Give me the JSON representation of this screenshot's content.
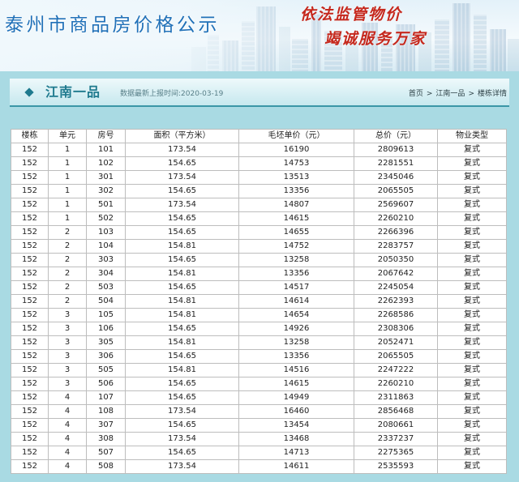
{
  "colors": {
    "page_background": "#a9dae3",
    "banner_title_blue": "#2171b8",
    "slogan_red": "#c5281d",
    "section_teal": "#1f7a8e",
    "table_border": "#bdbdbd"
  },
  "icons": {
    "section_bullet": "diamond-icon"
  },
  "banner": {
    "title": "泰州市商品房价格公示",
    "slogan": [
      "依法监管物价",
      "竭诚服务万家"
    ]
  },
  "section": {
    "title": "江南一品",
    "update_time": "数据最新上报时间:2020-03-19"
  },
  "breadcrumb": {
    "separator": ">",
    "items": [
      {
        "label": "首页"
      },
      {
        "label": "江南一品"
      },
      {
        "label": "楼栋详情"
      }
    ]
  },
  "table": {
    "columns": [
      "楼栋",
      "单元",
      "房号",
      "面积（平方米）",
      "毛坯单价（元）",
      "总价（元）",
      "物业类型"
    ],
    "rows": [
      [
        "152",
        "1",
        "101",
        "173.54",
        "16190",
        "2809613",
        "复式"
      ],
      [
        "152",
        "1",
        "102",
        "154.65",
        "14753",
        "2281551",
        "复式"
      ],
      [
        "152",
        "1",
        "301",
        "173.54",
        "13513",
        "2345046",
        "复式"
      ],
      [
        "152",
        "1",
        "302",
        "154.65",
        "13356",
        "2065505",
        "复式"
      ],
      [
        "152",
        "1",
        "501",
        "173.54",
        "14807",
        "2569607",
        "复式"
      ],
      [
        "152",
        "1",
        "502",
        "154.65",
        "14615",
        "2260210",
        "复式"
      ],
      [
        "152",
        "2",
        "103",
        "154.65",
        "14655",
        "2266396",
        "复式"
      ],
      [
        "152",
        "2",
        "104",
        "154.81",
        "14752",
        "2283757",
        "复式"
      ],
      [
        "152",
        "2",
        "303",
        "154.65",
        "13258",
        "2050350",
        "复式"
      ],
      [
        "152",
        "2",
        "304",
        "154.81",
        "13356",
        "2067642",
        "复式"
      ],
      [
        "152",
        "2",
        "503",
        "154.65",
        "14517",
        "2245054",
        "复式"
      ],
      [
        "152",
        "2",
        "504",
        "154.81",
        "14614",
        "2262393",
        "复式"
      ],
      [
        "152",
        "3",
        "105",
        "154.81",
        "14654",
        "2268586",
        "复式"
      ],
      [
        "152",
        "3",
        "106",
        "154.65",
        "14926",
        "2308306",
        "复式"
      ],
      [
        "152",
        "3",
        "305",
        "154.81",
        "13258",
        "2052471",
        "复式"
      ],
      [
        "152",
        "3",
        "306",
        "154.65",
        "13356",
        "2065505",
        "复式"
      ],
      [
        "152",
        "3",
        "505",
        "154.81",
        "14516",
        "2247222",
        "复式"
      ],
      [
        "152",
        "3",
        "506",
        "154.65",
        "14615",
        "2260210",
        "复式"
      ],
      [
        "152",
        "4",
        "107",
        "154.65",
        "14949",
        "2311863",
        "复式"
      ],
      [
        "152",
        "4",
        "108",
        "173.54",
        "16460",
        "2856468",
        "复式"
      ],
      [
        "152",
        "4",
        "307",
        "154.65",
        "13454",
        "2080661",
        "复式"
      ],
      [
        "152",
        "4",
        "308",
        "173.54",
        "13468",
        "2337237",
        "复式"
      ],
      [
        "152",
        "4",
        "507",
        "154.65",
        "14713",
        "2275365",
        "复式"
      ],
      [
        "152",
        "4",
        "508",
        "173.54",
        "14611",
        "2535593",
        "复式"
      ]
    ]
  }
}
